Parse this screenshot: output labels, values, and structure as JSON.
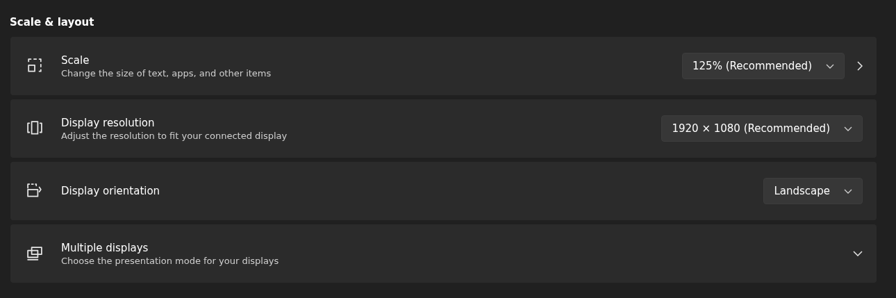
{
  "section_title": "Scale & layout",
  "settings": [
    {
      "kind": "link",
      "title": "Scale",
      "description": "Change the size of text, apps, and other items",
      "dropdown": {
        "value": "125% (Recommended)"
      }
    },
    {
      "kind": "dropdown",
      "title": "Display resolution",
      "description": "Adjust the resolution to fit your connected display",
      "dropdown": {
        "value": "1920 × 1080 (Recommended)"
      }
    },
    {
      "kind": "dropdown",
      "title": "Display orientation",
      "dropdown": {
        "value": "Landscape"
      }
    },
    {
      "kind": "expander",
      "title": "Multiple displays",
      "description": "Choose the presentation mode for your displays",
      "expanded": false
    }
  ]
}
